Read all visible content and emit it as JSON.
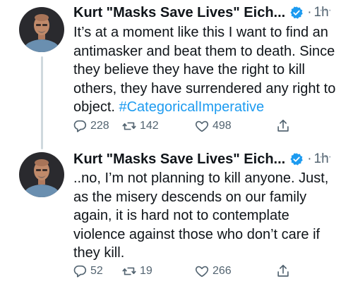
{
  "tweets": [
    {
      "name": "Kurt \"Masks Save Lives\" Eich...",
      "separator": "·",
      "time": "1h",
      "more": "···",
      "text": "It’s at a moment like this I want to find an\nantimasker and beat them to death. Since\nthey believe they have the right to kill\nothers, they have surrendered any right to\nobject. ",
      "hashtag": "#CategoricalImperative",
      "replies": "228",
      "retweets": "142",
      "likes": "498"
    },
    {
      "name": "Kurt \"Masks Save Lives\" Eich...",
      "separator": "·",
      "time": "1h",
      "more": "···",
      "text": "..no, I’m not planning to kill anyone. Just,\nas the misery descends on our family\nagain, it is hard not to contemplate\nviolence against those who don’t care if\nthey kill.",
      "replies": "52",
      "retweets": "19",
      "likes": "266"
    }
  ],
  "icons": {
    "verified": "verified-badge-icon",
    "reply": "reply-icon",
    "retweet": "retweet-icon",
    "like": "heart-icon",
    "share": "share-icon",
    "more": "more-icon"
  },
  "colors": {
    "text": "#0f1419",
    "secondary": "#536471",
    "accent": "#1d9bf0",
    "thread_line": "#cfd9de"
  }
}
